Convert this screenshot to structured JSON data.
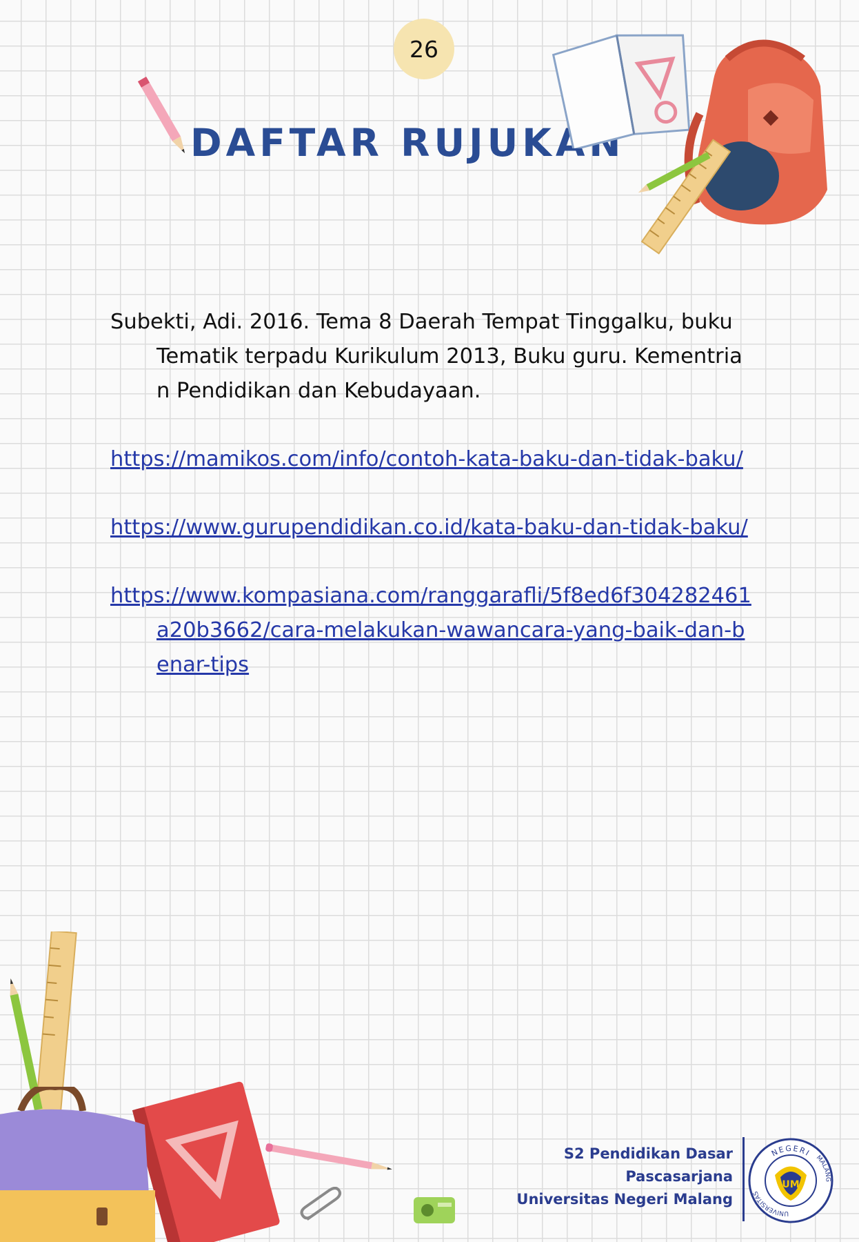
{
  "page": {
    "number": "26"
  },
  "title": "DAFTAR RUJUKAN",
  "references": [
    {
      "text": "Subekti, Adi. 2016. Tema 8 Daerah Tempat Tinggalku, buku Tematik terpadu Kurikulum 2013, Buku guru. Kementrian Pendidikan dan Kebudayaan.",
      "is_link": false
    },
    {
      "text": "https://mamikos.com/info/contoh-kata-baku-dan-tidak-baku/",
      "is_link": true
    },
    {
      "text": "https://www.gurupendidikan.co.id/kata-baku-dan-tidak-baku/",
      "is_link": true
    },
    {
      "text": "https://www.kompasiana.com/ranggarafli/5f8ed6f304282461a20b3662/cara-melakukan-wawancara-yang-baik-dan-benar-tips",
      "is_link": true
    }
  ],
  "footer": {
    "line1": "S2 Pendidikan Dasar",
    "line2": "Pascasarjana",
    "line3": "Universitas Negeri Malang",
    "seal_text_top": "NEGERI",
    "seal_text_left": "UNIVERSITAS",
    "seal_text_right": "MALANG",
    "seal_monogram": "UM"
  },
  "icons": [
    "pencil-icon",
    "notebook-icon",
    "backpack-icon",
    "ruler-icon",
    "book-icon",
    "paperclip-icon",
    "sharpener-icon",
    "university-seal-icon"
  ],
  "colors": {
    "title": "#2a4c94",
    "link": "#2538a8",
    "footer": "#2a3c8e",
    "badge": "#f6e4b0"
  }
}
